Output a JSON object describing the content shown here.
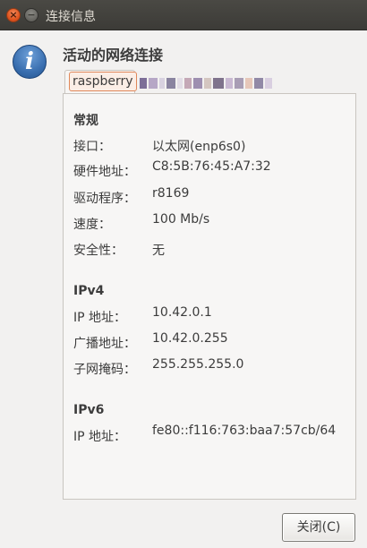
{
  "window": {
    "title": "连接信息",
    "close_glyph": "×",
    "minimize_glyph": "−"
  },
  "heading": "活动的网络连接",
  "icon_glyph": "i",
  "tabs": [
    {
      "label": "raspberry",
      "active": true
    },
    {
      "label": "",
      "active": false
    }
  ],
  "general": {
    "title": "常规",
    "rows": [
      {
        "label": "接口：",
        "value": "以太网(enp6s0)"
      },
      {
        "label": "硬件地址：",
        "value": "C8:5B:76:45:A7:32"
      },
      {
        "label": "驱动程序：",
        "value": "r8169"
      },
      {
        "label": "速度：",
        "value": "100 Mb/s"
      },
      {
        "label": "安全性：",
        "value": "无"
      }
    ]
  },
  "ipv4": {
    "title": "IPv4",
    "rows": [
      {
        "label": "IP 地址：",
        "value": "10.42.0.1"
      },
      {
        "label": "广播地址：",
        "value": "10.42.0.255"
      },
      {
        "label": "子网掩码：",
        "value": "255.255.255.0"
      }
    ]
  },
  "ipv6": {
    "title": "IPv6",
    "rows": [
      {
        "label": "IP 地址：",
        "value": "fe80::f116:763:baa7:57cb/64"
      }
    ]
  },
  "close_button": "关闭(C)",
  "colors": {
    "title_bar": "#3c3b37",
    "close_button_accent": "#e0541e",
    "info_icon": "#3a6fb0",
    "active_tab_highlight": "#e0885a"
  }
}
